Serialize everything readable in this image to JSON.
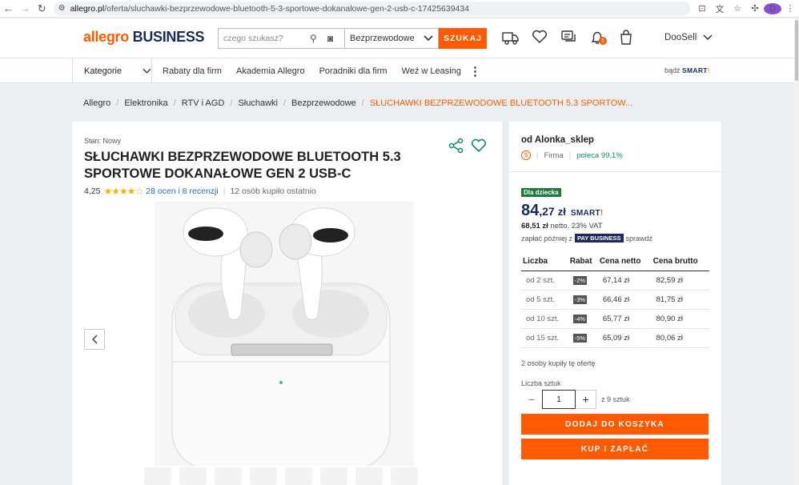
{
  "browser": {
    "url_host": "allegro.pl",
    "url_path": "/oferta/sluchawki-bezprzewodowe-bluetooth-5-3-sportowe-dokanalowe-gen-2-usb-c-17425639434",
    "profile_initial": "D"
  },
  "header": {
    "logo_part1": "allegro",
    "logo_part2": "BUSINESS",
    "search_placeholder": "czego szukasz?",
    "category_selected": "Bezprzewodowe",
    "search_button": "SZUKAJ",
    "notification_count": "6",
    "user_name": "DooSell"
  },
  "nav": {
    "categories_label": "Kategorie",
    "links": [
      "Rabaty dla firm",
      "Akademia Allegro",
      "Poradniki dla firm",
      "Weź w Leasing"
    ],
    "smart_prefix": "bądź",
    "smart_label": "SMART"
  },
  "breadcrumb": {
    "items": [
      "Allegro",
      "Elektronika",
      "RTV i AGD",
      "Słuchawki",
      "Bezprzewodowe"
    ],
    "current": "SŁUCHAWKI BEZPRZEWODOWE BLUETOOTH 5.3 SPORTOW..."
  },
  "product": {
    "condition": "Stan: Nowy",
    "title": "SŁUCHAWKI BEZPRZEWODOWE BLUETOOTH 5.3 SPORTOWE DOKANAŁOWE GEN 2 USB-C",
    "rating": "4,25",
    "stars": 4.25,
    "reviews_link": "28 ocen i 8 recenzji",
    "bought_recently": "12 osób kupiło ostatnio"
  },
  "seller": {
    "name": "od Alonka_sklep",
    "type": "Firma",
    "recommends": "poleca 99,1%",
    "badge": "Dla dziecka",
    "price_main": "84",
    "price_cents": ",27",
    "currency": "zł",
    "smart_label": "SMART",
    "netto_price": "68,51 zł",
    "netto_suffix": "netto, 23% VAT",
    "pay_later_prefix": "zapłać później z",
    "pay_badge": "PAY BUSINESS",
    "pay_check": "sprawdź",
    "table_headers": [
      "Liczba",
      "Rabat",
      "Cena netto",
      "Cena brutto"
    ],
    "tiers": [
      {
        "qty": "od 2 szt.",
        "discount": "-2%",
        "netto": "67,14 zł",
        "brutto": "82,59 zł"
      },
      {
        "qty": "od 5 szt.",
        "discount": "-3%",
        "netto": "66,46 zł",
        "brutto": "81,75 zł"
      },
      {
        "qty": "od 10 szt.",
        "discount": "-4%",
        "netto": "65,77 zł",
        "brutto": "80,90 zł"
      },
      {
        "qty": "od 15 szt.",
        "discount": "-5%",
        "netto": "65,09 zł",
        "brutto": "80,06 zł"
      }
    ],
    "bought_offer": "2 osoby kupiły tę ofertę",
    "qty_label": "Liczba sztuk",
    "qty_value": "1",
    "qty_of": "z 9 sztuk",
    "add_to_cart": "DODAJ DO KOSZYKA",
    "buy_now": "KUP I ZAPŁAĆ"
  },
  "colors": {
    "accent": "#ff5a00",
    "brand_navy": "#1a2a5e",
    "kid_badge": "#1f7a3a",
    "recommend_green": "#0e8a6d"
  }
}
